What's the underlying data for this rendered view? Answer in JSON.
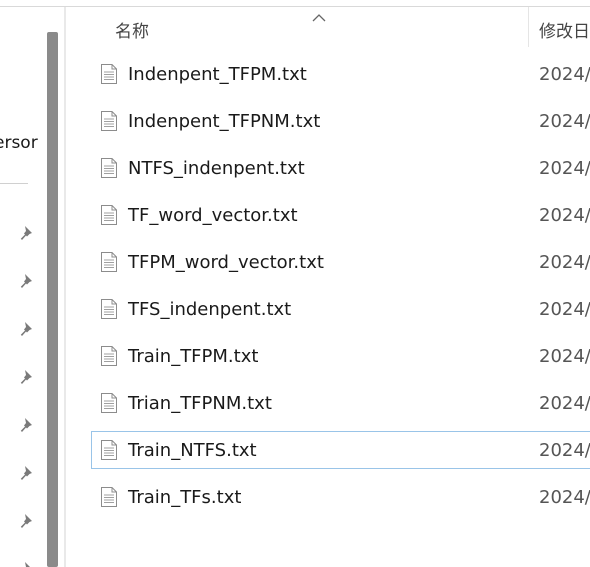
{
  "nav": {
    "partial_label": "ersor",
    "pinned_count": 8
  },
  "header": {
    "name_column": "名称",
    "date_column": "修改日"
  },
  "files": [
    {
      "name": "Indenpent_TFPM.txt",
      "date": "2024/"
    },
    {
      "name": "Indenpent_TFPNM.txt",
      "date": "2024/"
    },
    {
      "name": "NTFS_indenpent.txt",
      "date": "2024/"
    },
    {
      "name": "TF_word_vector.txt",
      "date": "2024/"
    },
    {
      "name": "TFPM_word_vector.txt",
      "date": "2024/"
    },
    {
      "name": "TFS_indenpent.txt",
      "date": "2024/"
    },
    {
      "name": "Train_TFPM.txt",
      "date": "2024/"
    },
    {
      "name": "Trian_TFPNM.txt",
      "date": "2024/"
    },
    {
      "name": "Train_NTFS.txt",
      "date": "2024/",
      "selected": true
    },
    {
      "name": "Train_TFs.txt",
      "date": "2024/"
    }
  ],
  "icons": {
    "file": "text-file-icon",
    "pin": "pin-icon",
    "sort": "sort-ascending-icon"
  },
  "colors": {
    "selection_border": "#99c4e8",
    "scrollbar_thumb": "#8a8a8a"
  }
}
